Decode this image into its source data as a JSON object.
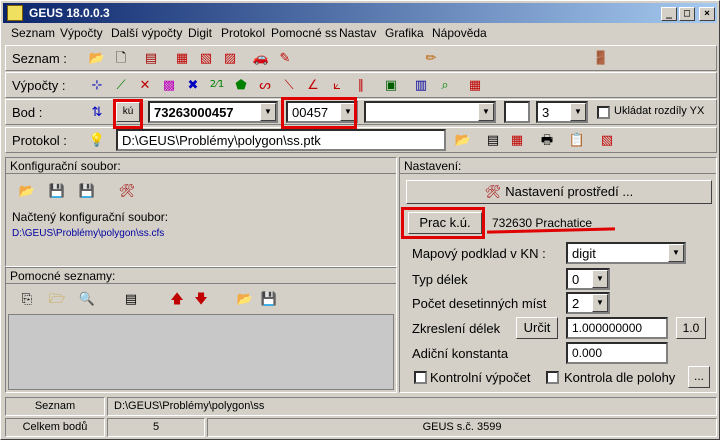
{
  "window": {
    "title": "GEUS 18.0.0.3",
    "btn_min": "_",
    "btn_max": "□",
    "btn_close": "×"
  },
  "menu": [
    "Seznam",
    "Výpočty",
    "Další výpočty",
    "Digit",
    "Protokol",
    "Pomocné ss",
    "Nastav",
    "Grafika",
    "Nápověda"
  ],
  "rows": {
    "seznam_label": "Seznam :",
    "vypocty_label": "Výpočty :",
    "bod_label": "Bod :",
    "protokol_label": "Protokol :"
  },
  "bod": {
    "ku_label": "kú",
    "point_number": "73263000457",
    "short_number": "00457",
    "combo3": "",
    "combo4": "",
    "precision": "3",
    "ukladat_label": "Ukládat rozdíly YX"
  },
  "protokol": {
    "path": "D:\\GEUS\\Problémy\\polygon\\ss.ptk"
  },
  "config": {
    "header": "Konfigurační soubor:",
    "loaded_label": "Načtený konfigurační soubor:",
    "loaded_path": "D:\\GEUS\\Problémy\\polygon\\ss.cfs"
  },
  "pomocne": {
    "header": "Pomocné seznamy:"
  },
  "nastaveni": {
    "header": "Nastavení:",
    "prostredi_button": "Nastavení prostředí ...",
    "prac_ku_button": "Prac k.ú.",
    "ku_value": "732630  Prachatice",
    "mapovy_label": "Mapový podklad v KN :",
    "mapovy_value": "digit",
    "typ_delek_label": "Typ délek",
    "typ_delek_value": "0",
    "pocet_label": "Počet desetinných míst",
    "pocet_value": "2",
    "zkresleni_label": "Zkreslení délek",
    "urcit_button": "Určit",
    "zkresleni_value": "1.000000000",
    "one_button": "1.0",
    "adicni_label": "Adiční konstanta",
    "adicni_value": "0.000",
    "kontrolni_label": "Kontrolní výpočet",
    "kontrola_label": "Kontrola dle polohy",
    "dots_button": "..."
  },
  "statusbar": {
    "seznam_label": "Seznam",
    "seznam_path": "D:\\GEUS\\Problémy\\polygon\\ss",
    "celkem_label": "Celkem bodů",
    "celkem_value": "5",
    "geus_label": "GEUS s.č. 3599"
  }
}
